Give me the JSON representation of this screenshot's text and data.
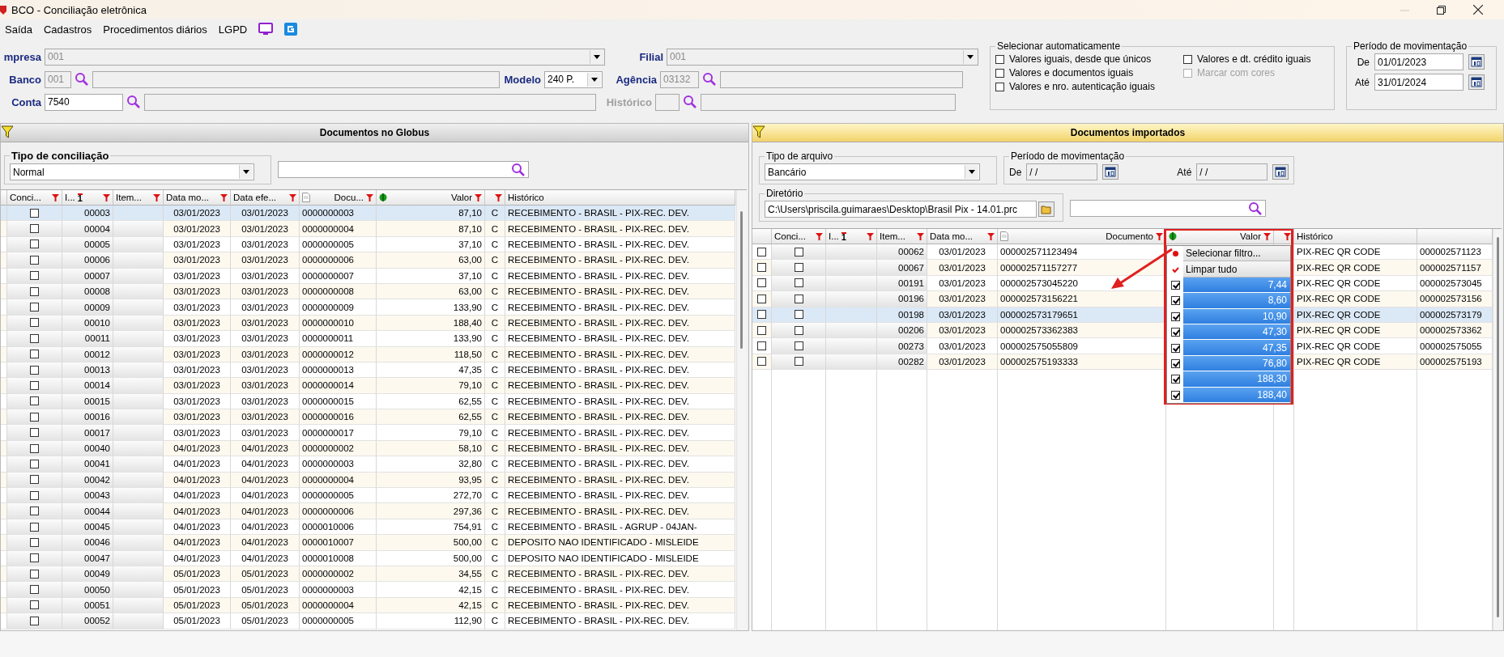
{
  "window": {
    "title": "BCO - Conciliação eletrônica"
  },
  "menu": [
    "Saída",
    "Cadastros",
    "Procedimentos diários",
    "LGPD"
  ],
  "form": {
    "empresa": {
      "label": "mpresa",
      "value": "001",
      "disabled": true
    },
    "filial": {
      "label": "Filial",
      "value": "001",
      "disabled": true
    },
    "banco": {
      "label": "Banco",
      "code": "001",
      "disabled": true
    },
    "modelo": {
      "label": "Modelo",
      "value": "240 P."
    },
    "agencia": {
      "label": "Agência",
      "code": "03132",
      "disabled": true
    },
    "conta": {
      "label": "Conta",
      "code": "7540",
      "disabled": false
    },
    "historico": {
      "label": "Histórico",
      "disabled": true
    }
  },
  "auto_select": {
    "title": "Selecionar automaticamente",
    "options": [
      {
        "label": "Valores iguais, desde que únicos",
        "checked": false,
        "disabled": false
      },
      {
        "label": "Valores e dt. crédito iguais",
        "checked": false,
        "disabled": false
      },
      {
        "label": "Valores e documentos iguais",
        "checked": false,
        "disabled": false
      },
      {
        "label": "Marcar com cores",
        "checked": false,
        "disabled": true
      },
      {
        "label": "Valores e nro. autenticação iguais",
        "checked": false,
        "disabled": false
      }
    ]
  },
  "periodo": {
    "title": "Período de movimentação",
    "de_label": "De",
    "de": "01/01/2023",
    "ate_label": "Até",
    "ate": "31/01/2024"
  },
  "left_panel": {
    "title": "Documentos no Globus",
    "active": false,
    "tipo": {
      "label": "Tipo de conciliação",
      "value": "Normal"
    },
    "columns": [
      {
        "kind": "text",
        "label": "Conci...",
        "filter": true
      },
      {
        "kind": "text",
        "label": "I...",
        "sort": "1",
        "filter": true
      },
      {
        "kind": "text",
        "label": "Item...",
        "filter": true
      },
      {
        "kind": "text",
        "label": "Data mo...",
        "filter": true
      },
      {
        "kind": "text",
        "label": "Data efe...",
        "filter": true
      },
      {
        "kind": "document",
        "label": "Docu...",
        "filter": true
      },
      {
        "kind": "money",
        "label": "Valor",
        "filter": true
      },
      {
        "kind": "text",
        "filter": true
      },
      {
        "kind": "text",
        "label": "Histórico",
        "filter": false
      }
    ],
    "rows": [
      {
        "checked": false,
        "selected": true,
        "i": "00003",
        "data_mo": "03/01/2023",
        "data_efe": "03/01/2023",
        "docu": "0000000003",
        "valor": "87,10",
        "tipo": "C",
        "historico": "RECEBIMENTO - BRASIL - PIX-REC. DEV."
      },
      {
        "checked": false,
        "selected": false,
        "i": "00004",
        "data_mo": "03/01/2023",
        "data_efe": "03/01/2023",
        "docu": "0000000004",
        "valor": "87,10",
        "tipo": "C",
        "historico": "RECEBIMENTO - BRASIL - PIX-REC. DEV."
      },
      {
        "checked": false,
        "selected": false,
        "i": "00005",
        "data_mo": "03/01/2023",
        "data_efe": "03/01/2023",
        "docu": "0000000005",
        "valor": "37,10",
        "tipo": "C",
        "historico": "RECEBIMENTO - BRASIL - PIX-REC. DEV."
      },
      {
        "checked": false,
        "selected": false,
        "i": "00006",
        "data_mo": "03/01/2023",
        "data_efe": "03/01/2023",
        "docu": "0000000006",
        "valor": "63,00",
        "tipo": "C",
        "historico": "RECEBIMENTO - BRASIL - PIX-REC. DEV."
      },
      {
        "checked": false,
        "selected": false,
        "i": "00007",
        "data_mo": "03/01/2023",
        "data_efe": "03/01/2023",
        "docu": "0000000007",
        "valor": "37,10",
        "tipo": "C",
        "historico": "RECEBIMENTO - BRASIL - PIX-REC. DEV."
      },
      {
        "checked": false,
        "selected": false,
        "i": "00008",
        "data_mo": "03/01/2023",
        "data_efe": "03/01/2023",
        "docu": "0000000008",
        "valor": "63,00",
        "tipo": "C",
        "historico": "RECEBIMENTO - BRASIL - PIX-REC. DEV."
      },
      {
        "checked": false,
        "selected": false,
        "i": "00009",
        "data_mo": "03/01/2023",
        "data_efe": "03/01/2023",
        "docu": "0000000009",
        "valor": "133,90",
        "tipo": "C",
        "historico": "RECEBIMENTO - BRASIL - PIX-REC. DEV."
      },
      {
        "checked": false,
        "selected": false,
        "i": "00010",
        "data_mo": "03/01/2023",
        "data_efe": "03/01/2023",
        "docu": "0000000010",
        "valor": "188,40",
        "tipo": "C",
        "historico": "RECEBIMENTO - BRASIL - PIX-REC. DEV."
      },
      {
        "checked": false,
        "selected": false,
        "i": "00011",
        "data_mo": "03/01/2023",
        "data_efe": "03/01/2023",
        "docu": "0000000011",
        "valor": "133,90",
        "tipo": "C",
        "historico": "RECEBIMENTO - BRASIL - PIX-REC. DEV."
      },
      {
        "checked": false,
        "selected": false,
        "i": "00012",
        "data_mo": "03/01/2023",
        "data_efe": "03/01/2023",
        "docu": "0000000012",
        "valor": "118,50",
        "tipo": "C",
        "historico": "RECEBIMENTO - BRASIL - PIX-REC. DEV."
      },
      {
        "checked": false,
        "selected": false,
        "i": "00013",
        "data_mo": "03/01/2023",
        "data_efe": "03/01/2023",
        "docu": "0000000013",
        "valor": "47,35",
        "tipo": "C",
        "historico": "RECEBIMENTO - BRASIL - PIX-REC. DEV."
      },
      {
        "checked": false,
        "selected": false,
        "i": "00014",
        "data_mo": "03/01/2023",
        "data_efe": "03/01/2023",
        "docu": "0000000014",
        "valor": "79,10",
        "tipo": "C",
        "historico": "RECEBIMENTO - BRASIL - PIX-REC. DEV."
      },
      {
        "checked": false,
        "selected": false,
        "i": "00015",
        "data_mo": "03/01/2023",
        "data_efe": "03/01/2023",
        "docu": "0000000015",
        "valor": "62,55",
        "tipo": "C",
        "historico": "RECEBIMENTO - BRASIL - PIX-REC. DEV."
      },
      {
        "checked": false,
        "selected": false,
        "i": "00016",
        "data_mo": "03/01/2023",
        "data_efe": "03/01/2023",
        "docu": "0000000016",
        "valor": "62,55",
        "tipo": "C",
        "historico": "RECEBIMENTO - BRASIL - PIX-REC. DEV."
      },
      {
        "checked": false,
        "selected": false,
        "i": "00017",
        "data_mo": "03/01/2023",
        "data_efe": "03/01/2023",
        "docu": "0000000017",
        "valor": "79,10",
        "tipo": "C",
        "historico": "RECEBIMENTO - BRASIL - PIX-REC. DEV."
      },
      {
        "checked": false,
        "selected": false,
        "i": "00040",
        "data_mo": "04/01/2023",
        "data_efe": "04/01/2023",
        "docu": "0000000002",
        "valor": "58,10",
        "tipo": "C",
        "historico": "RECEBIMENTO - BRASIL - PIX-REC. DEV."
      },
      {
        "checked": false,
        "selected": false,
        "i": "00041",
        "data_mo": "04/01/2023",
        "data_efe": "04/01/2023",
        "docu": "0000000003",
        "valor": "32,80",
        "tipo": "C",
        "historico": "RECEBIMENTO - BRASIL - PIX-REC. DEV."
      },
      {
        "checked": false,
        "selected": false,
        "i": "00042",
        "data_mo": "04/01/2023",
        "data_efe": "04/01/2023",
        "docu": "0000000004",
        "valor": "93,95",
        "tipo": "C",
        "historico": "RECEBIMENTO - BRASIL - PIX-REC. DEV."
      },
      {
        "checked": false,
        "selected": false,
        "i": "00043",
        "data_mo": "04/01/2023",
        "data_efe": "04/01/2023",
        "docu": "0000000005",
        "valor": "272,70",
        "tipo": "C",
        "historico": "RECEBIMENTO - BRASIL - PIX-REC. DEV."
      },
      {
        "checked": false,
        "selected": false,
        "i": "00044",
        "data_mo": "04/01/2023",
        "data_efe": "04/01/2023",
        "docu": "0000000006",
        "valor": "297,36",
        "tipo": "C",
        "historico": "RECEBIMENTO - BRASIL - PIX-REC. DEV."
      },
      {
        "checked": false,
        "selected": false,
        "i": "00045",
        "data_mo": "04/01/2023",
        "data_efe": "04/01/2023",
        "docu": "0000010006",
        "valor": "754,91",
        "tipo": "C",
        "historico": "RECEBIMENTO - BRASIL - AGRUP - 04JAN-"
      },
      {
        "checked": false,
        "selected": false,
        "i": "00046",
        "data_mo": "04/01/2023",
        "data_efe": "04/01/2023",
        "docu": "0000010007",
        "valor": "500,00",
        "tipo": "C",
        "historico": "DEPOSITO NAO IDENTIFICADO - MISLEIDE"
      },
      {
        "checked": false,
        "selected": false,
        "i": "00047",
        "data_mo": "04/01/2023",
        "data_efe": "04/01/2023",
        "docu": "0000010008",
        "valor": "500,00",
        "tipo": "C",
        "historico": "DEPOSITO NAO IDENTIFICADO - MISLEIDE"
      },
      {
        "checked": false,
        "selected": false,
        "i": "00049",
        "data_mo": "05/01/2023",
        "data_efe": "05/01/2023",
        "docu": "0000000002",
        "valor": "34,55",
        "tipo": "C",
        "historico": "RECEBIMENTO - BRASIL - PIX-REC. DEV."
      },
      {
        "checked": false,
        "selected": false,
        "i": "00050",
        "data_mo": "05/01/2023",
        "data_efe": "05/01/2023",
        "docu": "0000000003",
        "valor": "42,15",
        "tipo": "C",
        "historico": "RECEBIMENTO - BRASIL - PIX-REC. DEV."
      },
      {
        "checked": false,
        "selected": false,
        "i": "00051",
        "data_mo": "05/01/2023",
        "data_efe": "05/01/2023",
        "docu": "0000000004",
        "valor": "42,15",
        "tipo": "C",
        "historico": "RECEBIMENTO - BRASIL - PIX-REC. DEV."
      },
      {
        "checked": false,
        "selected": false,
        "i": "00052",
        "data_mo": "05/01/2023",
        "data_efe": "05/01/2023",
        "docu": "0000000005",
        "valor": "112,90",
        "tipo": "C",
        "historico": "RECEBIMENTO - BRASIL - PIX-REC. DEV."
      }
    ]
  },
  "right_panel": {
    "title": "Documentos importados",
    "active": true,
    "tipo_arquivo": {
      "label": "Tipo de arquivo",
      "value": "Bancário"
    },
    "periodo": {
      "label": "Período de movimentação",
      "de_label": "De",
      "de": "/ /",
      "ate_label": "Até",
      "ate": "/ /"
    },
    "diretorio": {
      "label": "Diretório",
      "value": "C:\\Users\\priscila.guimaraes\\Desktop\\Brasil Pix - 14.01.prc"
    },
    "columns": [
      {
        "kind": "text",
        "label": "Conci...",
        "filter": true
      },
      {
        "kind": "text",
        "label": "I...",
        "sort": "1",
        "filter": true
      },
      {
        "kind": "text",
        "label": "Item...",
        "filter": true
      },
      {
        "kind": "text",
        "label": "Data mo...",
        "filter": true
      },
      {
        "kind": "document",
        "label": "Documento",
        "filter": true
      },
      {
        "kind": "money",
        "label": "Valor",
        "filter": true
      },
      {
        "kind": "text",
        "filter": true
      },
      {
        "kind": "text",
        "label": "Histórico",
        "filter": false
      }
    ],
    "rows": [
      {
        "checked": false,
        "conci_checked": false,
        "selected": false,
        "item": "00062",
        "data_mo": "03/01/2023",
        "documento": "000002571123494",
        "historico": "PIX-REC QR CODE",
        "column_10": "000002571123"
      },
      {
        "checked": false,
        "conci_checked": false,
        "selected": false,
        "item": "00067",
        "data_mo": "03/01/2023",
        "documento": "000002571157277",
        "historico": "PIX-REC QR CODE",
        "column_10": "000002571157"
      },
      {
        "checked": false,
        "conci_checked": false,
        "selected": false,
        "item": "00191",
        "data_mo": "03/01/2023",
        "documento": "000002573045220",
        "historico": "PIX-REC QR CODE",
        "column_10": "000002573045"
      },
      {
        "checked": false,
        "conci_checked": false,
        "selected": false,
        "item": "00196",
        "data_mo": "03/01/2023",
        "documento": "000002573156221",
        "historico": "PIX-REC QR CODE",
        "column_10": "000002573156"
      },
      {
        "checked": false,
        "conci_checked": false,
        "selected": true,
        "item": "00198",
        "data_mo": "03/01/2023",
        "documento": "000002573179651",
        "historico": "PIX-REC QR CODE",
        "column_10": "000002573179"
      },
      {
        "checked": false,
        "conci_checked": false,
        "selected": false,
        "item": "00206",
        "data_mo": "03/01/2023",
        "documento": "000002573362383",
        "historico": "PIX-REC QR CODE",
        "column_10": "000002573362"
      },
      {
        "checked": false,
        "conci_checked": false,
        "selected": false,
        "item": "00273",
        "data_mo": "03/01/2023",
        "documento": "000002575055809",
        "historico": "PIX-REC QR CODE",
        "column_10": "000002575055"
      },
      {
        "checked": false,
        "conci_checked": false,
        "selected": false,
        "item": "00282",
        "data_mo": "03/01/2023",
        "documento": "000002575193333",
        "historico": "PIX-REC QR CODE",
        "column_10": "000002575193"
      }
    ],
    "filter_popup": {
      "actions": [
        {
          "kind": "dot",
          "label": "Selecionar filtro..."
        },
        {
          "kind": "check",
          "label": "Limpar tudo"
        }
      ],
      "values": [
        {
          "label": "7,44",
          "checked": true,
          "selected": true
        },
        {
          "label": "8,60",
          "checked": true,
          "selected": true
        },
        {
          "label": "10,90",
          "checked": true,
          "selected": true
        },
        {
          "label": "47,30",
          "checked": true,
          "selected": true
        },
        {
          "label": "47,35",
          "checked": true,
          "selected": true
        },
        {
          "label": "76,80",
          "checked": true,
          "selected": true
        },
        {
          "label": "188,30",
          "checked": true,
          "selected": true
        },
        {
          "label": "188,40",
          "checked": true,
          "selected": true
        }
      ]
    }
  }
}
